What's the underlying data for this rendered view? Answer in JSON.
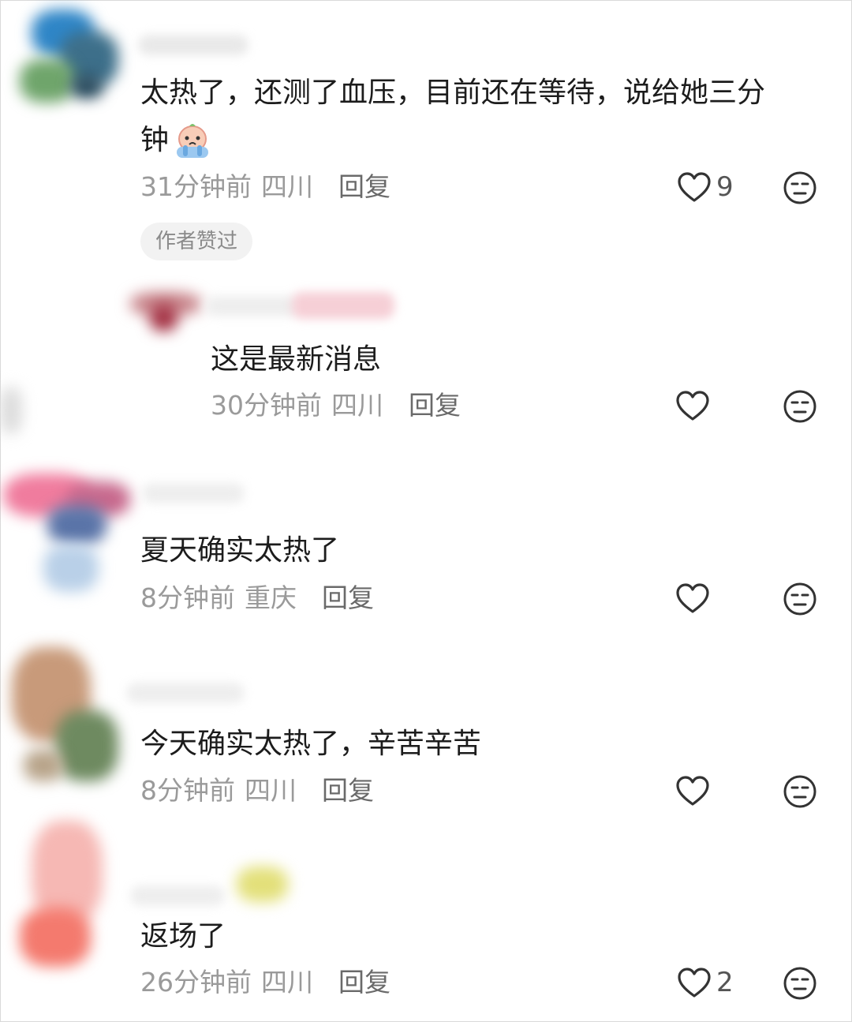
{
  "comments": [
    {
      "text_line1": "太热了，还测了血压，目前还在等待，说给她三分",
      "text_line2": "钟",
      "time": "31分钟前",
      "location": "四川",
      "reply": "回复",
      "likes": "9",
      "tag": "作者赞过"
    },
    {
      "text": "这是最新消息",
      "time": "30分钟前",
      "location": "四川",
      "reply": "回复"
    },
    {
      "text": "夏天确实太热了",
      "time": "8分钟前",
      "location": "重庆",
      "reply": "回复"
    },
    {
      "text": "今天确实太热了，辛苦辛苦",
      "time": "8分钟前",
      "location": "四川",
      "reply": "回复"
    },
    {
      "text": "返场了",
      "time": "26分钟前",
      "location": "四川",
      "reply": "回复",
      "likes": "2"
    }
  ],
  "icons": {
    "like": "heart-outline-icon",
    "dislike": "meh-face-icon",
    "emoji": "crying-face-emoji"
  }
}
